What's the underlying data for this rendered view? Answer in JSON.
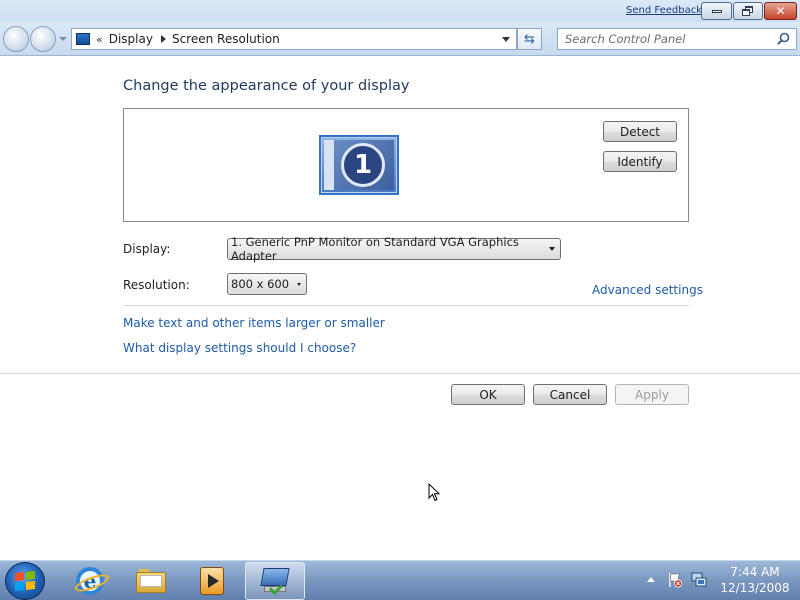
{
  "window": {
    "send_feedback": "Send Feedback"
  },
  "address_bar": {
    "overflow": "«",
    "breadcrumbs": [
      "Display",
      "Screen Resolution"
    ]
  },
  "search": {
    "placeholder": "Search Control Panel"
  },
  "main": {
    "heading": "Change the appearance of your display",
    "monitor_number": "1",
    "detect_label": "Detect",
    "identify_label": "Identify",
    "display_label": "Display:",
    "display_value": "1. Generic PnP Monitor on Standard VGA Graphics Adapter",
    "resolution_label": "Resolution:",
    "resolution_value": "800 x 600",
    "advanced_link": "Advanced settings",
    "larger_link": "Make text and other items larger or smaller",
    "help_link": "What display settings should I choose?",
    "ok_label": "OK",
    "cancel_label": "Cancel",
    "apply_label": "Apply"
  },
  "taskbar": {
    "pinned_icons": [
      "windows-start-icon",
      "internet-explorer-icon",
      "windows-explorer-icon",
      "media-player-icon",
      "control-panel-display-icon"
    ],
    "time": "7:44 AM",
    "date": "12/13/2008"
  },
  "colors": {
    "link": "#1e5aa8",
    "heading": "#1e395b",
    "taskbar": "#7d9ac2"
  }
}
